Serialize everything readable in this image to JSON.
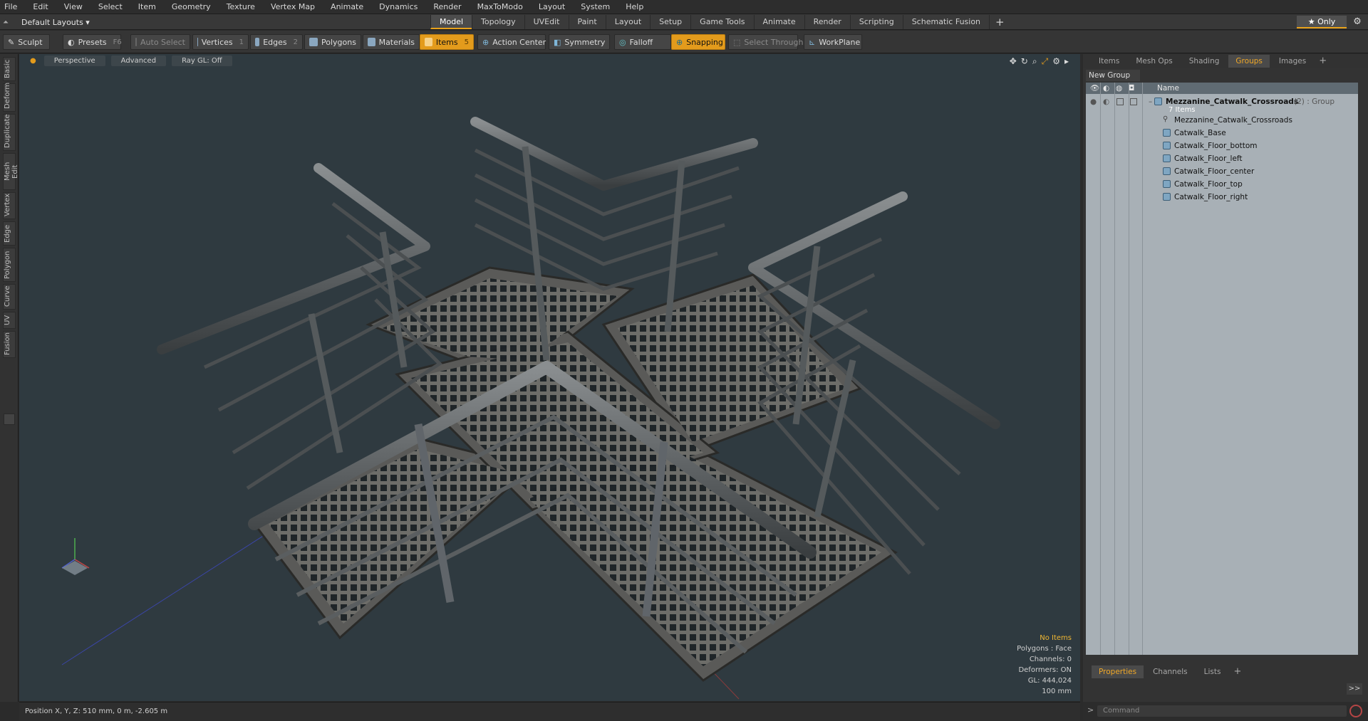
{
  "menu": [
    "File",
    "Edit",
    "View",
    "Select",
    "Item",
    "Geometry",
    "Texture",
    "Vertex Map",
    "Animate",
    "Dynamics",
    "Render",
    "MaxToModo",
    "Layout",
    "System",
    "Help"
  ],
  "layouts": {
    "label": "Default Layouts ▾"
  },
  "mode_tabs": [
    {
      "label": "Model",
      "active": true
    },
    {
      "label": "Topology"
    },
    {
      "label": "UVEdit"
    },
    {
      "label": "Paint"
    },
    {
      "label": "Layout"
    },
    {
      "label": "Setup"
    },
    {
      "label": "Game Tools"
    },
    {
      "label": "Animate"
    },
    {
      "label": "Render"
    },
    {
      "label": "Scripting"
    },
    {
      "label": "Schematic Fusion"
    }
  ],
  "only_label": "★  Only",
  "toolbar": {
    "sculpt": "Sculpt",
    "presets": "Presets",
    "presets_key": "F6",
    "auto_select": "Auto Select",
    "vertices": "Vertices",
    "vertices_n": "1",
    "edges": "Edges",
    "edges_n": "2",
    "polygons": "Polygons",
    "materials": "Materials",
    "items": "Items",
    "items_n": "5",
    "action_center": "Action Center",
    "symmetry": "Symmetry",
    "falloff": "Falloff",
    "snapping": "Snapping",
    "select_through": "Select Through",
    "workplane": "WorkPlane"
  },
  "left_tabs": [
    "Basic",
    "Deform",
    "Duplicate",
    "Mesh Edit",
    "Vertex",
    "Edge",
    "Polygon",
    "Curve",
    "UV",
    "Fusion"
  ],
  "viewport": {
    "perspective": "Perspective",
    "advanced": "Advanced",
    "raygl": "Ray GL: Off",
    "info": {
      "no_items": "No Items",
      "polygons": "Polygons : Face",
      "channels": "Channels: 0",
      "deformers": "Deformers: ON",
      "gl": "GL: 444,024",
      "scale": "100 mm"
    }
  },
  "status": "Position X, Y, Z:  510 mm, 0 m, -2.605 m",
  "right_tabs": [
    {
      "label": "Items"
    },
    {
      "label": "Mesh Ops"
    },
    {
      "label": "Shading"
    },
    {
      "label": "Groups",
      "active": true
    },
    {
      "label": "Images"
    }
  ],
  "new_group": "New Group",
  "col_name": "Name",
  "group": {
    "name": "Mezzanine_Catwalk_Crossroads",
    "count": " (2) : Group",
    "items": "7 Items"
  },
  "group_children": [
    "Mezzanine_Catwalk_Crossroads",
    "Catwalk_Base",
    "Catwalk_Floor_bottom",
    "Catwalk_Floor_left",
    "Catwalk_Floor_center",
    "Catwalk_Floor_top",
    "Catwalk_Floor_right"
  ],
  "bottom_tabs": [
    {
      "label": "Properties",
      "active": true
    },
    {
      "label": "Channels"
    },
    {
      "label": "Lists"
    }
  ],
  "command_placeholder": "Command",
  "colors": {
    "accent": "#e39b1c",
    "viewport_bg": "#2f3a40"
  }
}
